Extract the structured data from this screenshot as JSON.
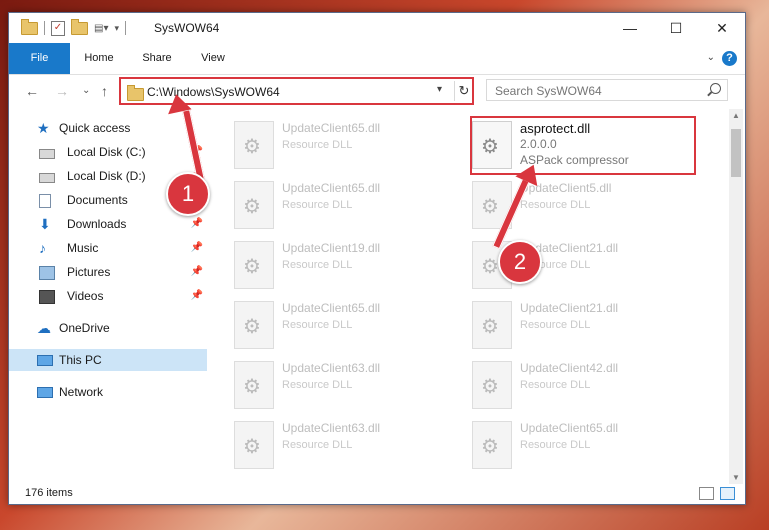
{
  "window": {
    "title": "SysWOW64",
    "minimize": "—",
    "maximize": "☐",
    "close": "✕"
  },
  "ribbon": {
    "tabs": [
      "File",
      "Home",
      "Share",
      "View"
    ],
    "help": "?"
  },
  "nav": {
    "back": "←",
    "forward": "→",
    "recent": "⌄",
    "up": "↑"
  },
  "address": {
    "path": "C:\\Windows\\SysWOW64",
    "refresh": "↻"
  },
  "search": {
    "placeholder": "Search SysWOW64"
  },
  "sidebar": {
    "items": [
      {
        "label": "Quick access",
        "icon": "star-icon",
        "pinned": false
      },
      {
        "label": "Local Disk (C:)",
        "icon": "drive-icon",
        "pinned": true
      },
      {
        "label": "Local Disk (D:)",
        "icon": "drive-icon",
        "pinned": true
      },
      {
        "label": "Documents",
        "icon": "documents-icon",
        "pinned": true
      },
      {
        "label": "Downloads",
        "icon": "download-icon",
        "pinned": true
      },
      {
        "label": "Music",
        "icon": "music-icon",
        "pinned": true
      },
      {
        "label": "Pictures",
        "icon": "pictures-icon",
        "pinned": true
      },
      {
        "label": "Videos",
        "icon": "videos-icon",
        "pinned": true
      },
      {
        "label": "OneDrive",
        "icon": "cloud-icon",
        "pinned": false
      },
      {
        "label": "This PC",
        "icon": "computer-icon",
        "pinned": false
      },
      {
        "label": "Network",
        "icon": "network-icon",
        "pinned": false
      }
    ],
    "selected": "This PC"
  },
  "files": {
    "left": [
      {
        "name": "UpdateClient65.dll",
        "desc": "Resource DLL"
      },
      {
        "name": "UpdateClient65.dll",
        "desc": "Resource DLL"
      },
      {
        "name": "UpdateClient19.dll",
        "desc": "Resource DLL"
      },
      {
        "name": "UpdateClient65.dll",
        "desc": "Resource DLL"
      },
      {
        "name": "UpdateClient63.dll",
        "desc": "Resource DLL"
      },
      {
        "name": "UpdateClient63.dll",
        "desc": "Resource DLL"
      }
    ],
    "right": [
      {
        "name": "asprotect.dll",
        "version": "2.0.0.0",
        "desc": "ASPack compressor",
        "highlighted": true
      },
      {
        "name": "UpdateClient5.dll",
        "desc": "Resource DLL"
      },
      {
        "name": "UpdateClient21.dll",
        "desc": "Resource DLL"
      },
      {
        "name": "UpdateClient21.dll",
        "desc": "Resource DLL"
      },
      {
        "name": "UpdateClient42.dll",
        "desc": "Resource DLL"
      },
      {
        "name": "UpdateClient65.dll",
        "desc": "Resource DLL"
      }
    ]
  },
  "status": {
    "count": "176 items"
  },
  "annotations": {
    "step1": "1",
    "step2": "2",
    "color": "#d9363e"
  }
}
